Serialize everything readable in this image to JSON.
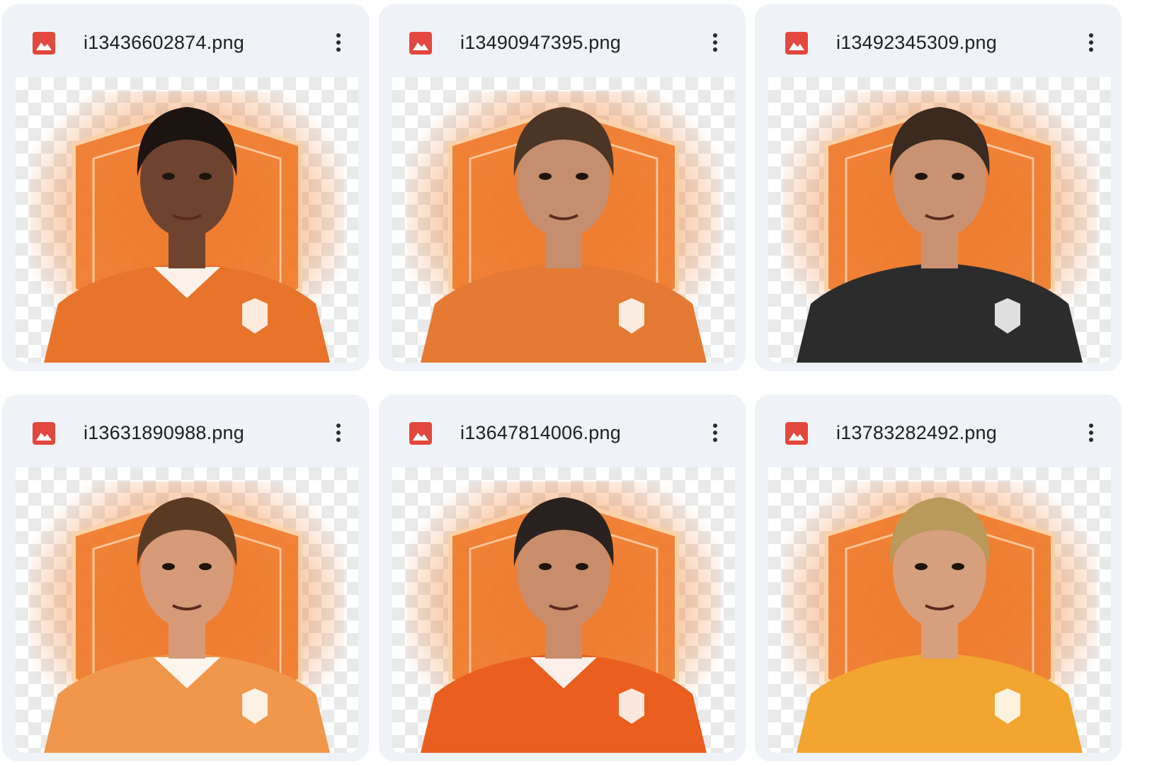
{
  "files": [
    {
      "name": "i13436602874.png",
      "icon": "image-file-icon",
      "menu_icon": "more-vert-icon",
      "preview": {
        "hair": "#1b1411",
        "skin": "#6e4431",
        "shirt": "#e8742c",
        "collar": "#ffffff"
      }
    },
    {
      "name": "i13490947395.png",
      "icon": "image-file-icon",
      "menu_icon": "more-vert-icon",
      "preview": {
        "hair": "#4a3526",
        "skin": "#c58e6f",
        "shirt": "#e57a34",
        "collar": "#e57a34"
      }
    },
    {
      "name": "i13492345309.png",
      "icon": "image-file-icon",
      "menu_icon": "more-vert-icon",
      "preview": {
        "hair": "#3a2a20",
        "skin": "#c99272",
        "shirt": "#2c2c2c",
        "collar": "#2c2c2c"
      }
    },
    {
      "name": "i13631890988.png",
      "icon": "image-file-icon",
      "menu_icon": "more-vert-icon",
      "preview": {
        "hair": "#5b3a24",
        "skin": "#d79a79",
        "shirt": "#f0974c",
        "collar": "#ffffff"
      }
    },
    {
      "name": "i13647814006.png",
      "icon": "image-file-icon",
      "menu_icon": "more-vert-icon",
      "preview": {
        "hair": "#2a2220",
        "skin": "#c98d6c",
        "shirt": "#ea5f1f",
        "collar": "#ffffff"
      }
    },
    {
      "name": "i13783282492.png",
      "icon": "image-file-icon",
      "menu_icon": "more-vert-icon",
      "preview": {
        "hair": "#b99a5a",
        "skin": "#d6a07e",
        "shirt": "#f2a531",
        "collar": "#f2a531"
      }
    }
  ],
  "colors": {
    "card_bg": "#eff2f7",
    "file_icon": "#e2483d",
    "badge_orange": "#f07a2a",
    "text": "#1f1f1f"
  }
}
